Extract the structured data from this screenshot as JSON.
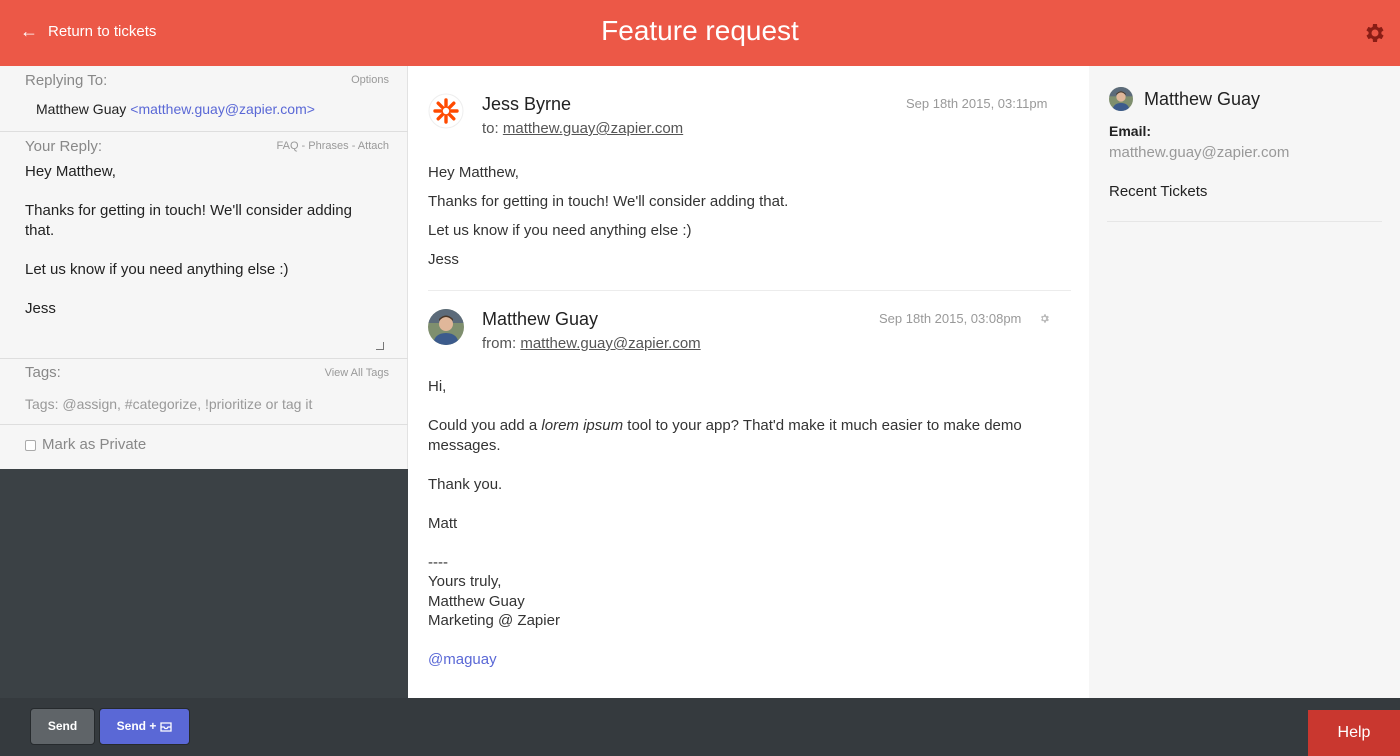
{
  "header": {
    "back_label": "Return to tickets",
    "title": "Feature request"
  },
  "reply_panel": {
    "replying_to_label": "Replying To:",
    "options_label": "Options",
    "recipient_name": "Matthew Guay",
    "recipient_email": "<matthew.guay@zapier.com>",
    "your_reply_label": "Your Reply:",
    "reply_links": "FAQ - Phrases - Attach",
    "reply_text": "Hey Matthew,\n\nThanks for getting in touch! We'll consider adding that.\n\nLet us know if you need anything else :)\n\nJess",
    "tags_label": "Tags:",
    "view_all_tags": "View All Tags",
    "tags_placeholder": "Tags: @assign, #categorize, !prioritize or tag it",
    "mark_private_label": "Mark as Private"
  },
  "messages": [
    {
      "author": "Jess Byrne",
      "to_prefix": "to:",
      "to_address": "matthew.guay@zapier.com",
      "date": "Sep 18th 2015, 03:11pm",
      "lines": [
        "Hey Matthew,",
        "Thanks for getting in touch! We'll consider adding that.",
        "Let us know if you need anything else :)",
        "Jess"
      ]
    },
    {
      "author": "Matthew Guay",
      "to_prefix": "from:",
      "to_address": "matthew.guay@zapier.com",
      "date": "Sep 18th 2015, 03:08pm",
      "greeting": "Hi,",
      "line1_pre": "Could you add a ",
      "line1_em": "lorem ipsum",
      "line1_post": " tool to your app? That'd make it much easier to make demo",
      "line1_cont": "messages.",
      "thanks": "Thank you.",
      "sign": "Matt",
      "sig_sep": "----",
      "sig_1": "Yours truly,",
      "sig_2": "Matthew Guay",
      "sig_3": "Marketing @ Zapier",
      "handle": "@maguay"
    }
  ],
  "customer": {
    "name": "Matthew Guay",
    "email_label": "Email:",
    "email": "matthew.guay@zapier.com",
    "recent_tickets_label": "Recent Tickets"
  },
  "footer": {
    "send_label": "Send",
    "send_plus_label": "Send +",
    "help_label": "Help"
  },
  "colors": {
    "header": "#ec5847",
    "accent": "#5a68d6",
    "help": "#c9372f",
    "footer": "#353a3e"
  }
}
